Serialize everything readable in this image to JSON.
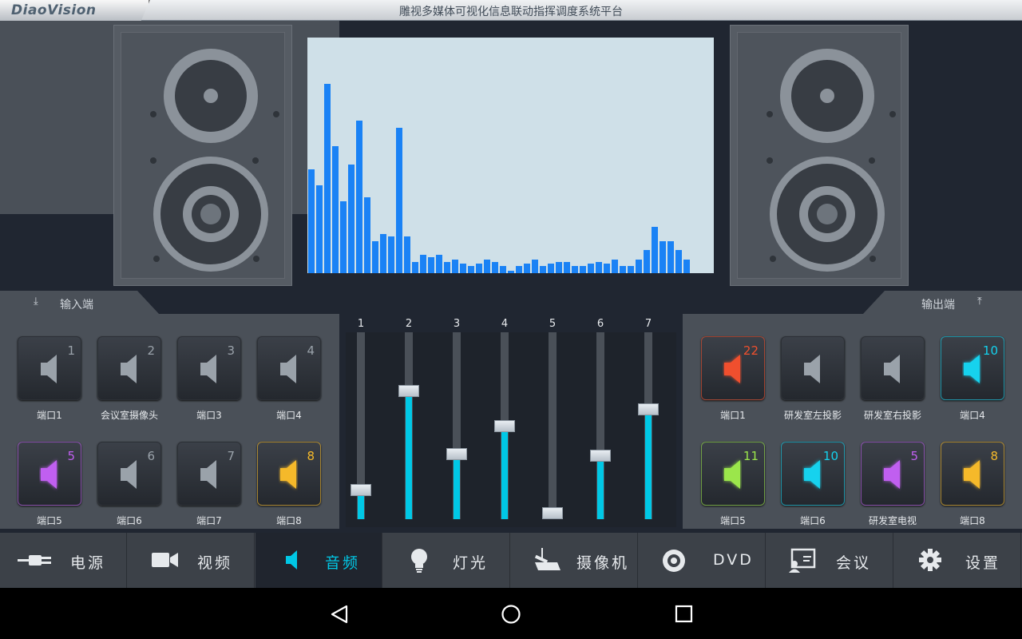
{
  "header": {
    "logo": "DiaoVision",
    "title": "雕视多媒体可视化信息联动指挥调度系统平台"
  },
  "spectrum": {
    "bar_color": "#1a82f5",
    "values": [
      0.45,
      0.38,
      0.82,
      0.55,
      0.31,
      0.47,
      0.66,
      0.33,
      0.14,
      0.17,
      0.16,
      0.63,
      0.16,
      0.05,
      0.08,
      0.07,
      0.08,
      0.05,
      0.06,
      0.04,
      0.03,
      0.04,
      0.06,
      0.05,
      0.03,
      0.01,
      0.03,
      0.04,
      0.06,
      0.03,
      0.04,
      0.05,
      0.05,
      0.03,
      0.03,
      0.04,
      0.05,
      0.04,
      0.06,
      0.03,
      0.03,
      0.06,
      0.1,
      0.2,
      0.14,
      0.14,
      0.1,
      0.06
    ]
  },
  "input": {
    "title": "输入端",
    "ports": [
      {
        "num": "1",
        "label": "端口1",
        "color": "#9aa2aa",
        "active": false
      },
      {
        "num": "2",
        "label": "会议室摄像头",
        "color": "#9aa2aa",
        "active": false
      },
      {
        "num": "3",
        "label": "端口3",
        "color": "#9aa2aa",
        "active": false
      },
      {
        "num": "4",
        "label": "端口4",
        "color": "#9aa2aa",
        "active": false
      },
      {
        "num": "5",
        "label": "端口5",
        "color": "#c05ff0",
        "active": true
      },
      {
        "num": "6",
        "label": "端口6",
        "color": "#9aa2aa",
        "active": false
      },
      {
        "num": "7",
        "label": "端口7",
        "color": "#9aa2aa",
        "active": false
      },
      {
        "num": "8",
        "label": "端口8",
        "color": "#f5b92a",
        "active": true
      }
    ]
  },
  "output": {
    "title": "输出端",
    "ports": [
      {
        "num": "22",
        "label": "端口1",
        "color": "#f0502d",
        "active": true
      },
      {
        "num": "",
        "label": "研发室左投影",
        "color": "#9aa2aa",
        "active": false
      },
      {
        "num": "",
        "label": "研发室右投影",
        "color": "#9aa2aa",
        "active": false
      },
      {
        "num": "10",
        "label": "端口4",
        "color": "#14d2ee",
        "active": true
      },
      {
        "num": "11",
        "label": "端口5",
        "color": "#9be64b",
        "active": true
      },
      {
        "num": "10",
        "label": "端口6",
        "color": "#14d2ee",
        "active": true
      },
      {
        "num": "5",
        "label": "研发室电视",
        "color": "#c05ff0",
        "active": true
      },
      {
        "num": "8",
        "label": "端口8",
        "color": "#f5b92a",
        "active": true
      }
    ]
  },
  "mixer": {
    "channels": [
      "1",
      "2",
      "3",
      "4",
      "5",
      "6",
      "7"
    ],
    "levels": [
      0.15,
      0.79,
      0.38,
      0.56,
      0.0,
      0.37,
      0.67
    ],
    "fill_color": "#00c8e6"
  },
  "nav": {
    "items": [
      {
        "label": "电源",
        "icon": "power-plug-icon",
        "active": false
      },
      {
        "label": "视频",
        "icon": "video-camera-icon",
        "active": false
      },
      {
        "label": "音频",
        "icon": "speaker-icon",
        "active": true
      },
      {
        "label": "灯光",
        "icon": "light-bulb-icon",
        "active": false
      },
      {
        "label": "摄像机",
        "icon": "surveillance-camera-icon",
        "active": false
      },
      {
        "label": "DVD",
        "icon": "disc-icon",
        "active": false
      },
      {
        "label": "会议",
        "icon": "meeting-screen-icon",
        "active": false
      },
      {
        "label": "设置",
        "icon": "gear-icon",
        "active": false
      }
    ]
  },
  "system_bar": {
    "back": "back-icon",
    "home": "home-icon",
    "recents": "recents-icon"
  }
}
